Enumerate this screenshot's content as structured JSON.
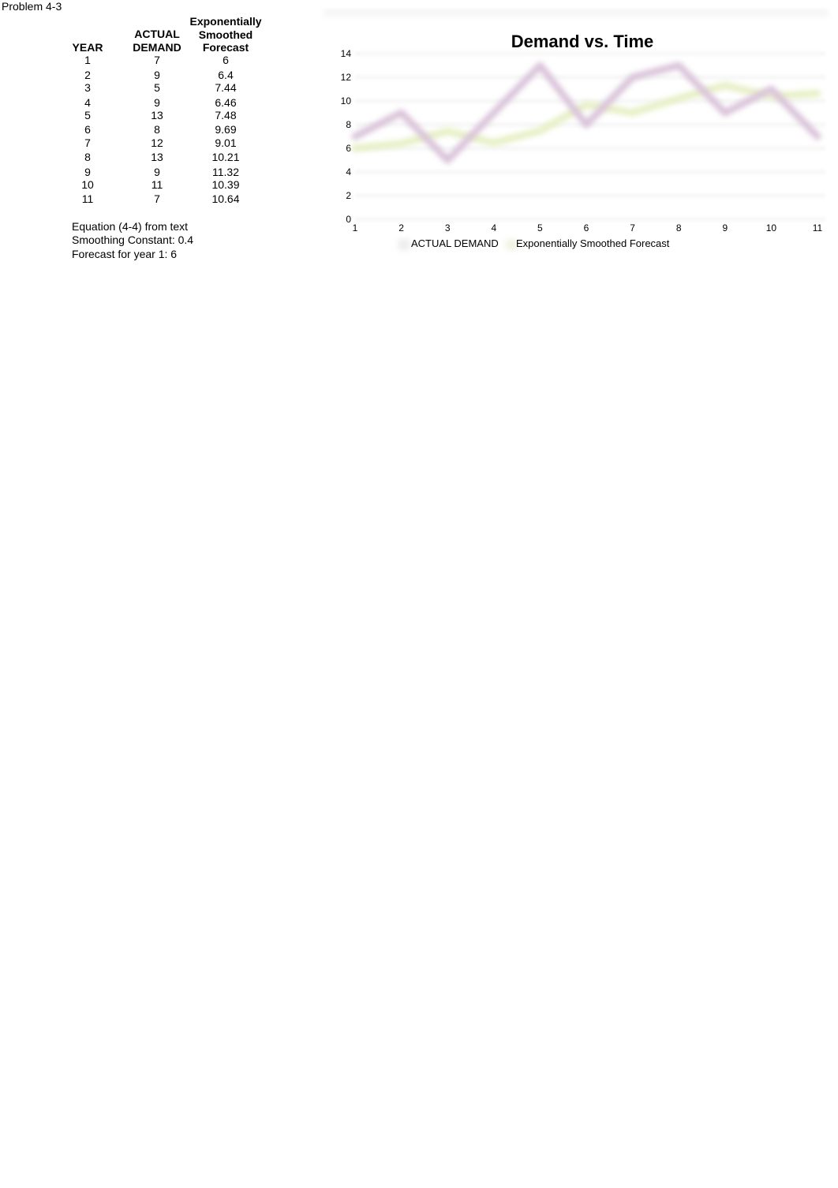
{
  "sheet": {
    "title": "Problem 4-3",
    "headers": {
      "year": "YEAR",
      "actual_line1": "ACTUAL",
      "actual_line2": "DEMAND",
      "forecast_line1": "Exponentially",
      "forecast_line2": "Smoothed",
      "forecast_line3": "Forecast"
    },
    "rows": [
      {
        "year": "1",
        "actual": "7",
        "forecast": "6"
      },
      {
        "year": "2",
        "actual": "9",
        "forecast": "6.4"
      },
      {
        "year": "3",
        "actual": "5",
        "forecast": "7.44"
      },
      {
        "year": "4",
        "actual": "9",
        "forecast": "6.46"
      },
      {
        "year": "5",
        "actual": "13",
        "forecast": "7.48"
      },
      {
        "year": "6",
        "actual": "8",
        "forecast": "9.69"
      },
      {
        "year": "7",
        "actual": "12",
        "forecast": "9.01"
      },
      {
        "year": "8",
        "actual": "13",
        "forecast": "10.21"
      },
      {
        "year": "9",
        "actual": "9",
        "forecast": "11.32"
      },
      {
        "year": "10",
        "actual": "11",
        "forecast": "10.39"
      },
      {
        "year": "11",
        "actual": "7",
        "forecast": "10.64"
      }
    ],
    "notes": [
      "Equation (4-4) from text",
      "Smoothing Constant:  0.4",
      "Forecast for year 1:  6"
    ]
  },
  "chart_data": {
    "type": "line",
    "title": "Demand vs. Time",
    "xlabel": "",
    "ylabel": "",
    "x": [
      1,
      2,
      3,
      4,
      5,
      6,
      7,
      8,
      9,
      10,
      11
    ],
    "x_tick_labels": [
      "1",
      "2",
      "3",
      "4",
      "5",
      "6",
      "7",
      "8",
      "9",
      "10",
      "11"
    ],
    "y_tick_labels": [
      "0",
      "2",
      "4",
      "6",
      "8",
      "10",
      "12",
      "14"
    ],
    "ylim": [
      0,
      14
    ],
    "xlim": [
      1,
      11
    ],
    "grid": true,
    "legend_position": "bottom",
    "series": [
      {
        "name": "ACTUAL DEMAND",
        "color": "#d9c3d9",
        "values": [
          7,
          9,
          5,
          9,
          13,
          8,
          12,
          13,
          9,
          11,
          7
        ]
      },
      {
        "name": "Exponentially Smoothed Forecast",
        "color": "#e6efc4",
        "values": [
          6,
          6.4,
          7.44,
          6.46,
          7.48,
          9.69,
          9.01,
          10.21,
          11.32,
          10.39,
          10.64
        ]
      }
    ]
  }
}
